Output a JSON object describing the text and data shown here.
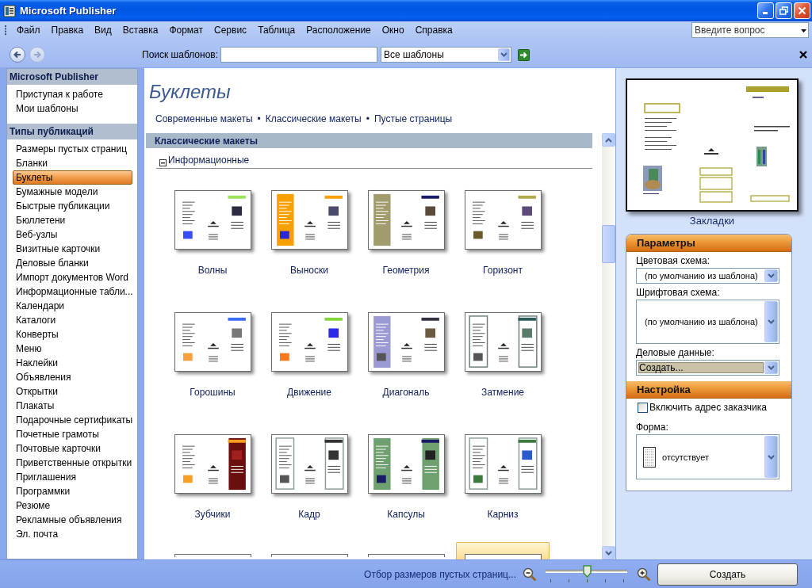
{
  "window": {
    "title": "Microsoft Publisher"
  },
  "menu_bar": {
    "items": [
      "Файл",
      "Правка",
      "Вид",
      "Вставка",
      "Формат",
      "Сервис",
      "Таблица",
      "Расположение",
      "Окно",
      "Справка"
    ],
    "help_box": {
      "placeholder": "Введите вопрос"
    }
  },
  "toolbar": {
    "back": {
      "disabled": false
    },
    "forward": {
      "disabled": true
    },
    "search": {
      "label": "Поиск шаблонов:"
    },
    "scope": {
      "value": "Все шаблоны"
    }
  },
  "sidebar": {
    "sections": [
      {
        "title": "Microsoft Publisher",
        "items": [
          {
            "label": "Приступая к работе",
            "selected": false
          },
          {
            "label": "Мои шаблоны",
            "selected": false
          }
        ]
      },
      {
        "title": "Типы публикаций",
        "items": [
          {
            "label": "Размеры пустых страниц",
            "selected": false
          },
          {
            "label": "Бланки",
            "selected": false
          },
          {
            "label": "Буклеты",
            "selected": true
          },
          {
            "label": "Бумажные модели",
            "selected": false
          },
          {
            "label": "Быстрые публикации",
            "selected": false
          },
          {
            "label": "Бюллетени",
            "selected": false
          },
          {
            "label": "Веб-узлы",
            "selected": false
          },
          {
            "label": "Визитные карточки",
            "selected": false
          },
          {
            "label": "Деловые бланки",
            "selected": false
          },
          {
            "label": "Импорт документов Word",
            "selected": false
          },
          {
            "label": "Информационные табли...",
            "selected": false
          },
          {
            "label": "Календари",
            "selected": false
          },
          {
            "label": "Каталоги",
            "selected": false
          },
          {
            "label": "Конверты",
            "selected": false
          },
          {
            "label": "Меню",
            "selected": false
          },
          {
            "label": "Наклейки",
            "selected": false
          },
          {
            "label": "Объявления",
            "selected": false
          },
          {
            "label": "Открытки",
            "selected": false
          },
          {
            "label": "Плакаты",
            "selected": false
          },
          {
            "label": "Подарочные сертификаты",
            "selected": false
          },
          {
            "label": "Почетные грамоты",
            "selected": false
          },
          {
            "label": "Почтовые карточки",
            "selected": false
          },
          {
            "label": "Приветственные открытки",
            "selected": false
          },
          {
            "label": "Приглашения",
            "selected": false
          },
          {
            "label": "Программки",
            "selected": false
          },
          {
            "label": "Резюме",
            "selected": false
          },
          {
            "label": "Рекламные объявления",
            "selected": false
          },
          {
            "label": "Эл. почта",
            "selected": false
          }
        ]
      }
    ]
  },
  "content": {
    "title": "Буклеты",
    "links": [
      "Современные макеты",
      "Классические макеты",
      "Пустые страницы"
    ],
    "link_separator": "•",
    "section": {
      "title": "Классические макеты",
      "groups": [
        {
          "title": "Информационные",
          "expanded": true,
          "templates": [
            {
              "label": "Волны",
              "selected": false
            },
            {
              "label": "Выноски",
              "selected": false
            },
            {
              "label": "Геометрия",
              "selected": false
            },
            {
              "label": "Горизонт",
              "selected": false
            },
            {
              "label": "Горошины",
              "selected": false
            },
            {
              "label": "Движение",
              "selected": false
            },
            {
              "label": "Диагональ",
              "selected": false
            },
            {
              "label": "Затмение",
              "selected": false
            },
            {
              "label": "Зубчики",
              "selected": false
            },
            {
              "label": "Кадр",
              "selected": false
            },
            {
              "label": "Капсулы",
              "selected": false
            },
            {
              "label": "Карниз",
              "selected": false
            },
            {
              "selected": false
            },
            {
              "selected": false
            },
            {
              "selected": false
            },
            {
              "selected": true
            }
          ]
        }
      ]
    }
  },
  "preview": {
    "caption": "Закладки"
  },
  "options": {
    "title": "Параметры",
    "fields": [
      {
        "kind": "dropdown",
        "label": "Цветовая схема:",
        "value": "(по умолчанию из шаблона)",
        "highlighted": false
      },
      {
        "kind": "listbox",
        "label": "Шрифтовая схема:",
        "value": "(по умолчанию из шаблона)",
        "highlighted": false
      },
      {
        "kind": "dropdown",
        "label": "Деловые данные:",
        "value": "Создать...",
        "highlighted": true
      }
    ]
  },
  "customize": {
    "title": "Настройка",
    "checkbox": {
      "label": "Включить адрес заказчика",
      "checked": false
    },
    "fields": [
      {
        "kind": "picker",
        "label": "Форма:",
        "value": "отсутствует",
        "highlighted": false
      }
    ]
  },
  "status_bar": {
    "link": "Отбор размеров пустых страниц...",
    "zoom": {
      "level": 0.5
    },
    "button": "Создать"
  }
}
